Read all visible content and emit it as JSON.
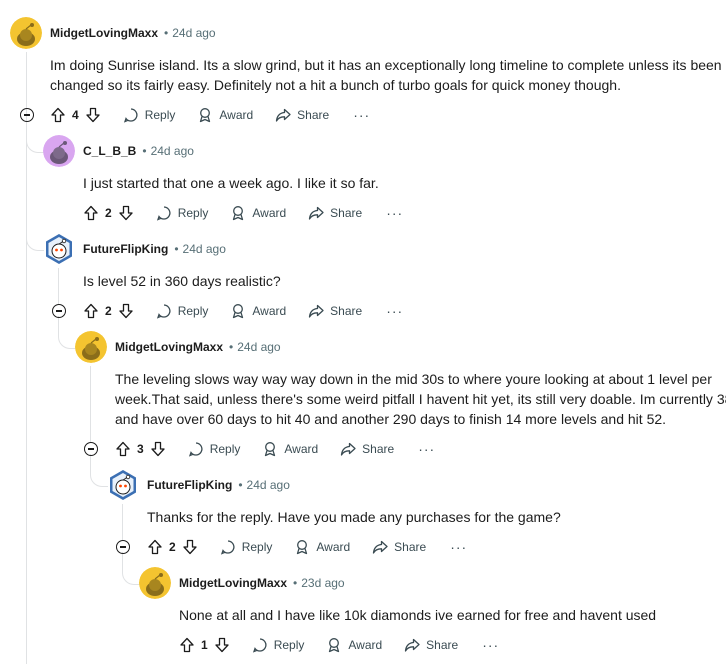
{
  "comments": [
    {
      "author": "MidgetLovingMaxx",
      "time": "24d ago",
      "avatar": "snoo-yellow",
      "lines": [
        "Im doing Sunrise island.  Its a slow grind, but it has an exceptionally long timeline to complete unless its been",
        "changed so its fairly easy.  Definitely not a hit a bunch of turbo goals for quick money though."
      ],
      "score": "4"
    },
    {
      "author": "C_L_B_B",
      "time": "24d ago",
      "avatar": "snoo-purple",
      "lines": [
        "I just started that one a week ago. I like it so far."
      ],
      "score": "2"
    },
    {
      "author": "FutureFlipKing",
      "time": "24d ago",
      "avatar": "snoo-hex-blue",
      "lines": [
        "Is level 52 in 360 days realistic?"
      ],
      "score": "2"
    },
    {
      "author": "MidgetLovingMaxx",
      "time": "24d ago",
      "avatar": "snoo-yellow",
      "lines": [
        "The leveling slows way way way down in the mid 30s to where youre looking at about 1 level per",
        "week.That said, unless there's some weird pitfall I havent hit yet, its still very doable.  Im currently 38",
        "and have over 60 days to hit 40 and another 290 days to finish 14 more levels and hit 52."
      ],
      "score": "3"
    },
    {
      "author": "FutureFlipKing",
      "time": "24d ago",
      "avatar": "snoo-hex-blue",
      "lines": [
        "Thanks for the reply.  Have you made any purchases for the game?"
      ],
      "score": "2"
    },
    {
      "author": "MidgetLovingMaxx",
      "time": "23d ago",
      "avatar": "snoo-yellow",
      "lines": [
        "None at all and I have like 10k diamonds ive earned for free and havent used"
      ],
      "score": "1"
    }
  ],
  "actions": {
    "reply": "Reply",
    "award": "Award",
    "share": "Share",
    "more": "···"
  },
  "colors": {
    "meta": "#576f76",
    "thread_line": "#e0e2e4",
    "yellow_avatar": "#f4c430",
    "purple_avatar": "#d9a6f0",
    "hex_avatar": "#3b6fb3"
  }
}
